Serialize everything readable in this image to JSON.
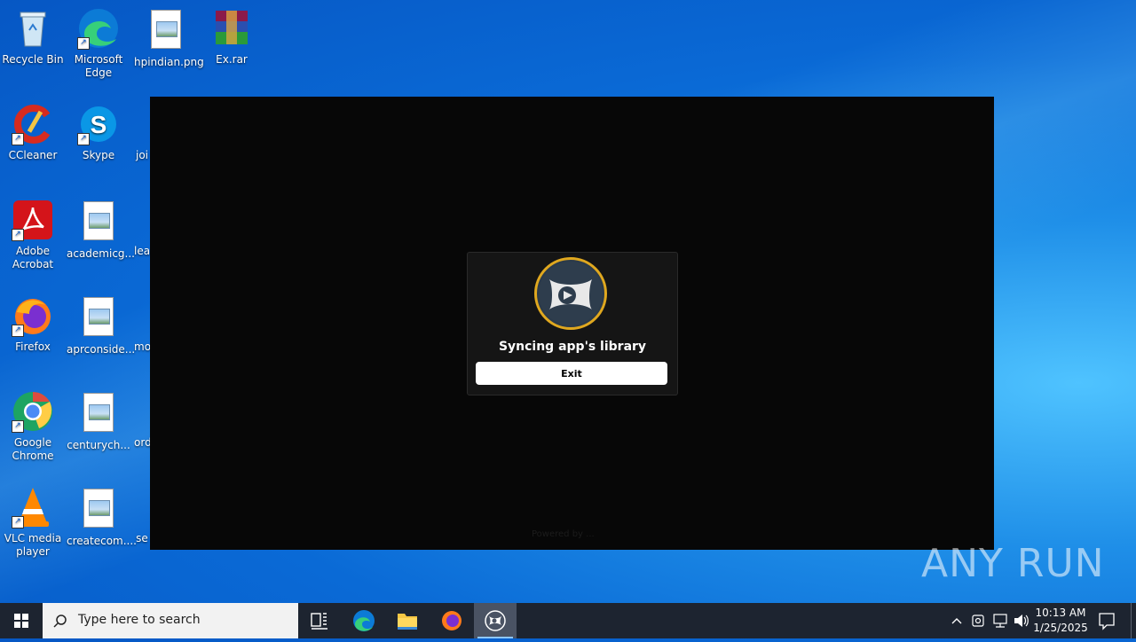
{
  "desktop": {
    "icons": [
      {
        "label": "Recycle Bin"
      },
      {
        "label": "Microsoft Edge"
      },
      {
        "label": "hpindian.png"
      },
      {
        "label": "Ex.rar"
      },
      {
        "label": "CCleaner"
      },
      {
        "label": "Skype"
      },
      {
        "label": "joi"
      },
      {
        "label": "Adobe Acrobat"
      },
      {
        "label": "academicg..."
      },
      {
        "label": "lea"
      },
      {
        "label": "Firefox"
      },
      {
        "label": "aprconside..."
      },
      {
        "label": "mo"
      },
      {
        "label": "Google Chrome"
      },
      {
        "label": "centurych..."
      },
      {
        "label": "ord"
      },
      {
        "label": "VLC media player"
      },
      {
        "label": "createcom...."
      },
      {
        "label": "se"
      }
    ]
  },
  "app": {
    "dialog_title": "Syncing app's library",
    "exit_label": "Exit",
    "footer_text": "Powered by ..."
  },
  "watermark": {
    "text": "ANY RUN"
  },
  "taskbar": {
    "search_placeholder": "Type here to search",
    "time": "10:13 AM",
    "date": "1/25/2025"
  },
  "colors": {
    "desktop_blue": "#0a6ad6",
    "taskbar": "#1d2430",
    "logo_ring": "#e0a81f"
  }
}
